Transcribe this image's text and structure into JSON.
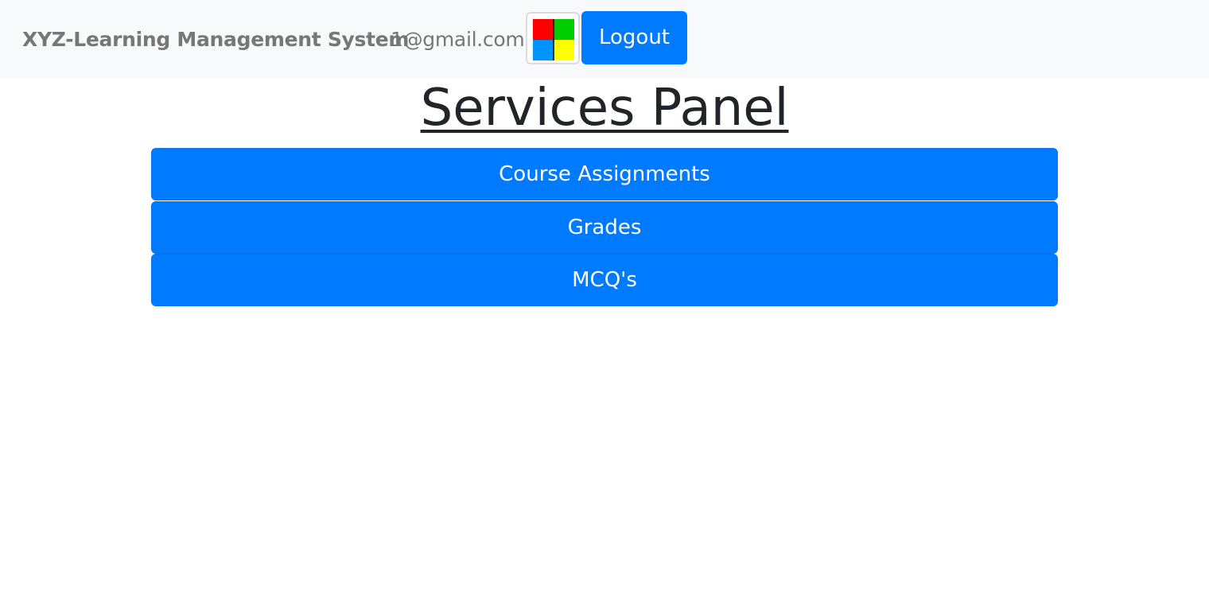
{
  "navbar": {
    "brand": "XYZ-Learning Management System",
    "email": "1@gmail.com",
    "apps_icon": "four-color-grid-icon",
    "apps_colors": [
      "#ff0000",
      "#00cc00",
      "#0094ff",
      "#ffff00"
    ],
    "logout_label": "Logout"
  },
  "main": {
    "title": "Services Panel",
    "services": [
      {
        "label": "Course Assignments"
      },
      {
        "label": "Grades"
      },
      {
        "label": "MCQ's"
      }
    ]
  },
  "colors": {
    "accent": "#007bff",
    "navbar_bg": "#f8f9fa",
    "text_muted": "#777777",
    "title_text": "#212529"
  }
}
